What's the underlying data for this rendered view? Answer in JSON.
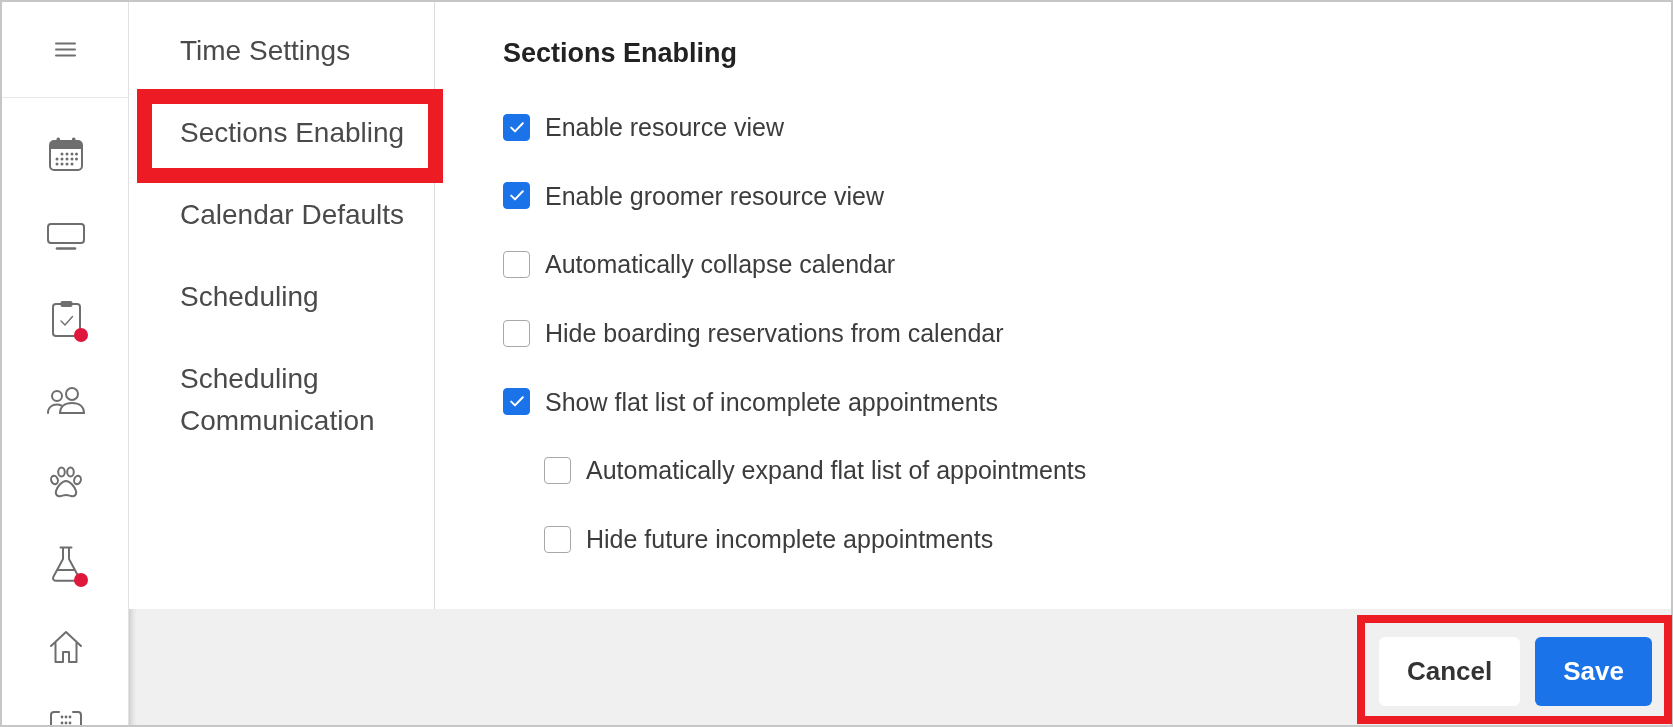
{
  "rail": {
    "items": [
      {
        "badge": false
      },
      {
        "badge": false
      },
      {
        "badge": true
      },
      {
        "badge": false
      },
      {
        "badge": false
      },
      {
        "badge": true
      },
      {
        "badge": false
      },
      {
        "badge": false
      }
    ]
  },
  "settings_nav": {
    "items": [
      {
        "label": "Time Settings",
        "annotated": false
      },
      {
        "label": "Sections Enabling",
        "annotated": true
      },
      {
        "label": "Calendar Defaults",
        "annotated": false
      },
      {
        "label": "Scheduling",
        "annotated": false
      },
      {
        "label": "Scheduling Communication",
        "annotated": false
      }
    ]
  },
  "section": {
    "title": "Sections Enabling",
    "options": [
      {
        "label": "Enable resource view",
        "checked": true
      },
      {
        "label": "Enable groomer resource view",
        "checked": true
      },
      {
        "label": "Automatically collapse calendar",
        "checked": false
      },
      {
        "label": "Hide boarding reservations from calendar",
        "checked": false
      },
      {
        "label": "Show flat list of incomplete appointments",
        "checked": true,
        "children": [
          {
            "label": "Automatically expand flat list of appointments",
            "checked": false
          },
          {
            "label": "Hide future incomplete appointments",
            "checked": false
          }
        ]
      }
    ]
  },
  "footer": {
    "annotated": true,
    "buttons": [
      {
        "label": "Cancel",
        "kind": "secondary"
      },
      {
        "label": "Save",
        "kind": "primary"
      }
    ]
  }
}
